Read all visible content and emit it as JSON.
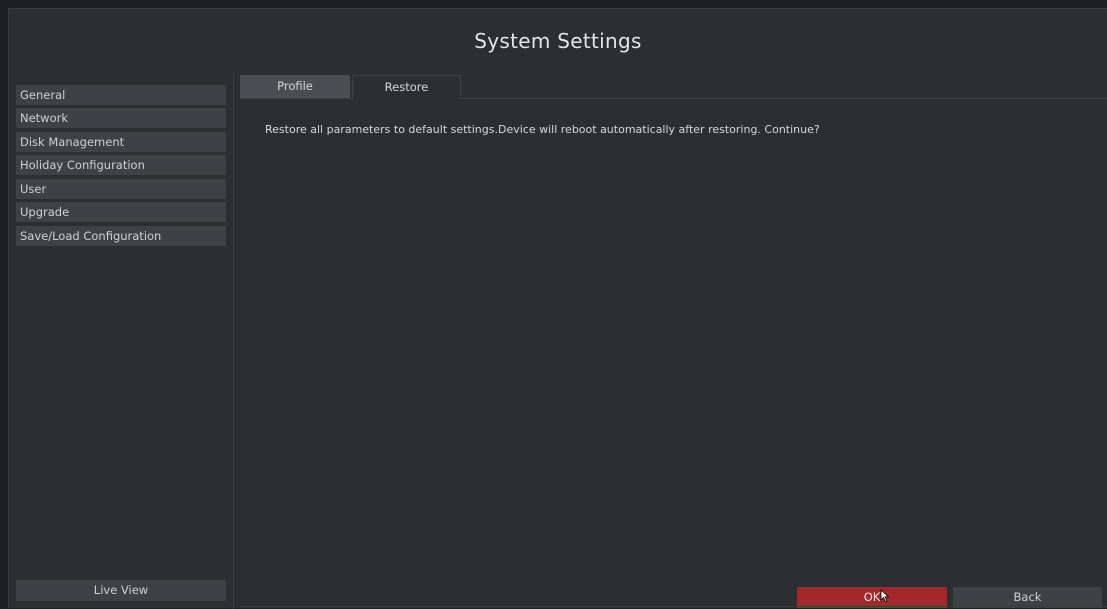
{
  "window": {
    "title": "System Settings"
  },
  "sidebar": {
    "items": [
      {
        "label": "General"
      },
      {
        "label": "Network"
      },
      {
        "label": "Disk Management"
      },
      {
        "label": "Holiday Configuration"
      },
      {
        "label": "User"
      },
      {
        "label": "Upgrade"
      },
      {
        "label": "Save/Load Configuration"
      }
    ],
    "live_view_label": "Live View"
  },
  "tabs": [
    {
      "label": "Profile",
      "active": false
    },
    {
      "label": "Restore",
      "active": true
    }
  ],
  "main": {
    "message": "Restore all parameters to default settings.Device will reboot automatically after restoring. Continue?"
  },
  "buttons": {
    "ok_label": "OK",
    "back_label": "Back"
  },
  "colors": {
    "background": "#2c2e31",
    "accent_ok": "#a3272b",
    "item_bg": "#3e4145"
  },
  "icons": {
    "cursor": "mouse-pointer-icon"
  }
}
